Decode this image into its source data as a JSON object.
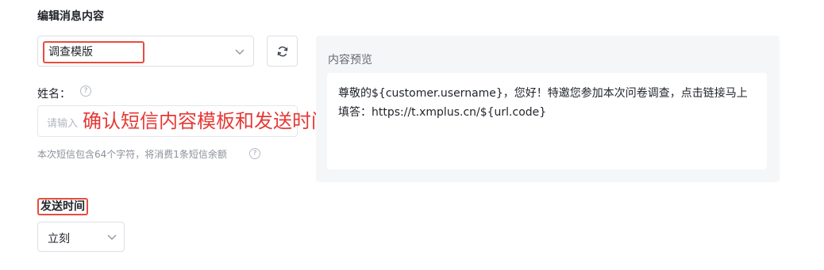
{
  "section": {
    "title": "编辑消息内容"
  },
  "template_select": {
    "value": "调查模版",
    "chevron_icon": "chevron-down-icon"
  },
  "refresh_button": {
    "icon": "refresh-icon"
  },
  "name_field": {
    "label": "姓名：",
    "help_icon": "?",
    "placeholder": "请输入"
  },
  "annotation": {
    "text": "确认短信内容模板和发送时间",
    "color": "#e53935"
  },
  "char_count_note": "本次短信包含64个字符，将消费1条短信余额",
  "preview": {
    "title": "内容预览",
    "body": "尊敬的${customer.username}，您好！特邀您参加本次问卷调查，点击链接马上填答：https://t.xmplus.cn/${url.code}"
  },
  "send_time": {
    "label": "发送时间",
    "value": "立刻"
  },
  "colors": {
    "highlight": "#e84c3d",
    "preview_bg": "#f5f6f8"
  }
}
